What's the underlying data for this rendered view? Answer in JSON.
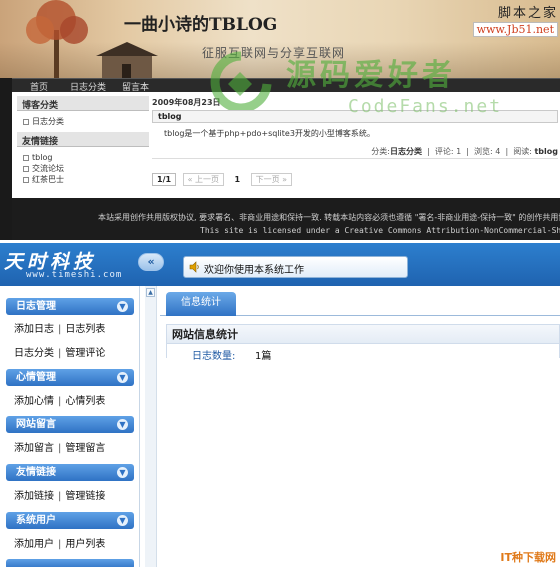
{
  "blog": {
    "title": "一曲小诗的TBLOG",
    "subtitle": "征服互联网与分享互联网",
    "nav": [
      "首页",
      "日志分类",
      "留言本"
    ],
    "sidebar": {
      "blog_category_heading": "博客分类",
      "categories": [
        "日志分类"
      ],
      "links_heading": "友情链接",
      "links": [
        "tblog",
        "交流论坛",
        "红茶巴士"
      ]
    },
    "post": {
      "date": "2009年08月23日",
      "title": "tblog",
      "body": "tblog是一个基于php+pdo+sqlite3开发的小型博客系统。",
      "meta_category_label": "分类:",
      "meta_category": "日志分类",
      "meta_comments": "评论: 1",
      "meta_views": "浏览: 4",
      "meta_read_label": "阅读:",
      "meta_read": "tblog"
    },
    "pager": {
      "page_info": "1/1",
      "prev": "« 上一页",
      "current": "1",
      "next": "下一页 »"
    },
    "footer_cn": "本站采用创作共用版权协议, 要求署名、非商业用途和保持一致. 转载本站内容必须也遵循 \"署名-非商业用途-保持一致\" 的创作共用协议.",
    "footer_en": "This site is licensed under a Creative Commons Attribution-NonCommercial-ShareAlike 2.5 License."
  },
  "watermarks": {
    "jb51_line1": "脚本之家",
    "jb51_line2": "www.Jb51.net",
    "codefans_cn": "源码爱好者",
    "codefans_en": "CodeFans.net",
    "corner": "IT种下载网"
  },
  "admin": {
    "logo": "天时科技",
    "url": "www.timeshi.com",
    "collapse_icon": "«",
    "welcome": "欢迎你使用本系统工作",
    "menu": [
      {
        "heading": "日志管理",
        "rows": [
          [
            "添加日志",
            "日志列表"
          ],
          [
            "日志分类",
            "管理评论"
          ]
        ]
      },
      {
        "heading": "心情管理",
        "rows": [
          [
            "添加心情",
            "心情列表"
          ]
        ]
      },
      {
        "heading": "网站留言",
        "rows": [
          [
            "添加留言",
            "管理留言"
          ]
        ]
      },
      {
        "heading": "友情链接",
        "rows": [
          [
            "添加链接",
            "管理链接"
          ]
        ]
      },
      {
        "heading": "系统用户",
        "rows": [
          [
            "添加用户",
            "用户列表"
          ]
        ]
      }
    ],
    "row_separator": "|",
    "tab": "信息统计",
    "stat_title": "网站信息统计",
    "stat_label": "日志数量:",
    "stat_value": "1篇"
  },
  "colors": {
    "admin_header": "#1f63b0",
    "menu_head": "#2f72c4",
    "watermark_green": "#50af3c",
    "corner_orange": "#e07a1a"
  }
}
